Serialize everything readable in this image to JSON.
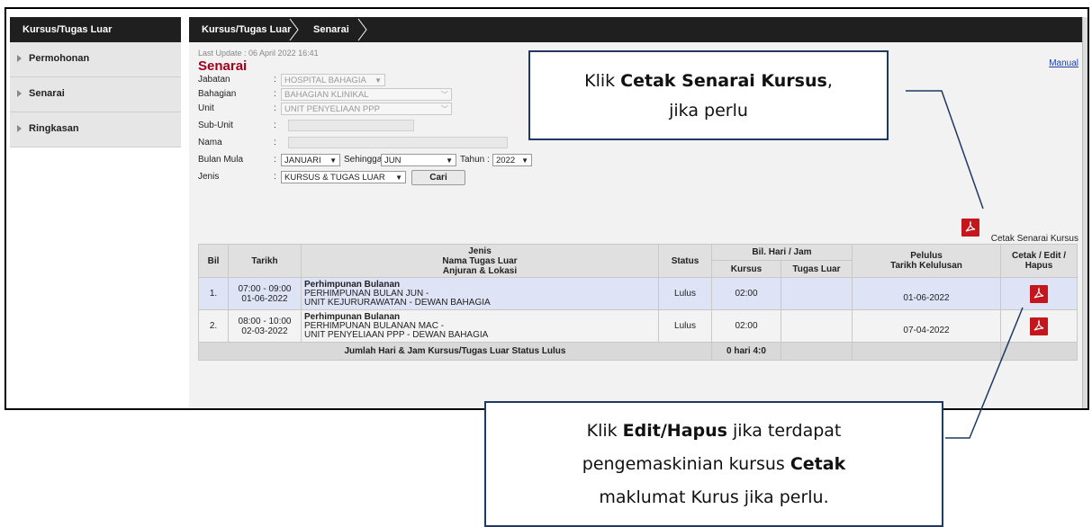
{
  "sidebar": {
    "header": "Kursus/Tugas Luar",
    "items": [
      {
        "label": "Permohonan"
      },
      {
        "label": "Senarai"
      },
      {
        "label": "Ringkasan"
      }
    ]
  },
  "breadcrumb": [
    "Kursus/Tugas Luar",
    "Senarai"
  ],
  "last_update": "Last Update : 06 April 2022 16:41",
  "manual_link": "Manual",
  "page_title": "Senarai",
  "form": {
    "jabatan": {
      "label": "Jabatan",
      "value": "HOSPITAL BAHAGIA"
    },
    "bahagian": {
      "label": "Bahagian",
      "value": "BAHAGIAN KLINIKAL"
    },
    "unit": {
      "label": "Unit",
      "value": "UNIT PENYELIAAN PPP"
    },
    "subunit": {
      "label": "Sub-Unit",
      "value": ""
    },
    "nama": {
      "label": "Nama",
      "value": ""
    },
    "bulan_mula": {
      "label": "Bulan Mula",
      "value": "JANUARI"
    },
    "sehingga": {
      "label": "Sehingga:",
      "value": "JUN"
    },
    "tahun": {
      "label": "Tahun :",
      "value": "2022"
    },
    "jenis": {
      "label": "Jenis",
      "value": "KURSUS & TUGAS LUAR"
    },
    "cari_label": "Cari"
  },
  "cetak_senarai_label": "Cetak Senarai Kursus",
  "table": {
    "headers": {
      "bil": "Bil",
      "tarikh": "Tarikh",
      "jenis_line1": "Jenis",
      "jenis_line2": "Nama Tugas Luar",
      "jenis_line3": "Anjuran & Lokasi",
      "status": "Status",
      "bil_hari": "Bil. Hari / Jam",
      "kursus": "Kursus",
      "tugas_luar": "Tugas Luar",
      "pelulus_line1": "Pelulus",
      "pelulus_line2": "Tarikh Kelulusan",
      "cetak_line1": "Cetak / Edit /",
      "cetak_line2": "Hapus"
    },
    "rows": [
      {
        "bil": "1.",
        "time": "07:00 - 09:00",
        "date": "01-06-2022",
        "type": "Perhimpunan Bulanan",
        "name": "PERHIMPUNAN BULAN JUN -",
        "org": "UNIT KEJURURAWATAN - DEWAN BAHAGIA",
        "status": "Lulus",
        "kursus": "02:00",
        "tugas_luar": "",
        "approval_date": "01-06-2022"
      },
      {
        "bil": "2.",
        "time": "08:00 - 10:00",
        "date": "02-03-2022",
        "type": "Perhimpunan Bulanan",
        "name": "PERHIMPUNAN BULANAN MAC -",
        "org": "UNIT PENYELIAAN PPP - DEWAN BAHAGIA",
        "status": "Lulus",
        "kursus": "02:00",
        "tugas_luar": "",
        "approval_date": "07-04-2022"
      }
    ],
    "footer_label": "Jumlah Hari & Jam Kursus/Tugas Luar Status Lulus",
    "footer_total": "0 hari 4:0"
  },
  "callouts": {
    "top": {
      "pre": "Klik ",
      "bold": "Cetak Senarai Kursus",
      "post": ",",
      "line2": "jika perlu"
    },
    "bottom": {
      "line1_pre": "Klik ",
      "line1_bold": "Edit/Hapus",
      "line1_post": " jika terdapat",
      "line2_pre": "pengemaskinian kursus  ",
      "line2_bold": "Cetak",
      "line3": "maklumat Kurus jika perlu."
    }
  },
  "colors": {
    "title": "#a3001b",
    "pdf_icon": "#c4161c",
    "callout_border": "#1f3864",
    "header_bar": "#1f1f1f"
  }
}
